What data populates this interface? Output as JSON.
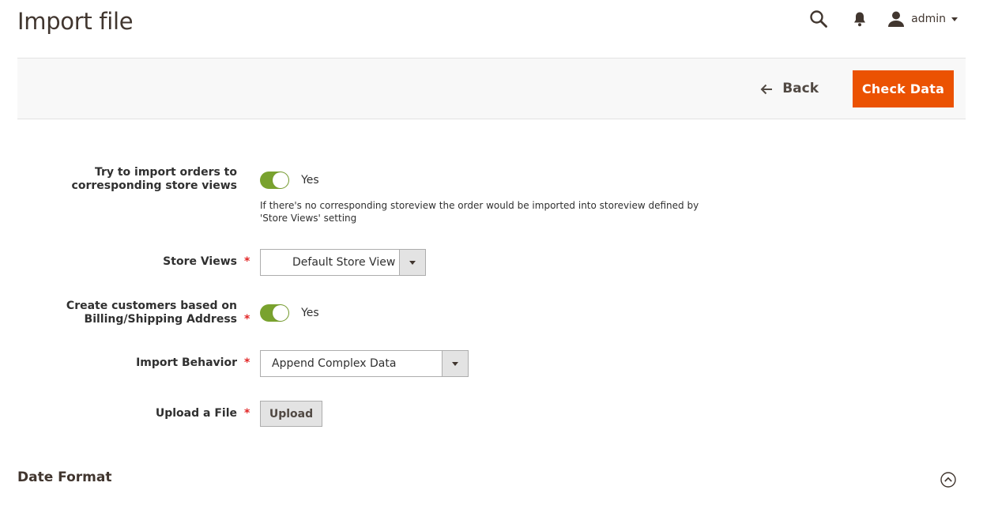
{
  "page": {
    "title": "Import file"
  },
  "header": {
    "user_name": "admin"
  },
  "actions": {
    "back_label": "Back",
    "check_data_label": "Check Data"
  },
  "form": {
    "import_to_store_views": {
      "label": "Try to import orders to corresponding store views",
      "value": "Yes",
      "enabled": true,
      "note": "If there's no corresponding storeview the order would be imported into storeview defined by 'Store Views' setting"
    },
    "store_views": {
      "label": "Store Views",
      "value": "Default Store View"
    },
    "create_customers": {
      "label": "Create customers based on Billing/Shipping Address",
      "value": "Yes",
      "enabled": true
    },
    "import_behavior": {
      "label": "Import Behavior",
      "value": "Append Complex Data"
    },
    "upload_file": {
      "label": "Upload a File",
      "button_label": "Upload"
    }
  },
  "sections": {
    "date_format": "Date Format"
  },
  "colors": {
    "accent": "#eb5202",
    "toggle_on": "#79a22e",
    "required": "#e22626"
  }
}
